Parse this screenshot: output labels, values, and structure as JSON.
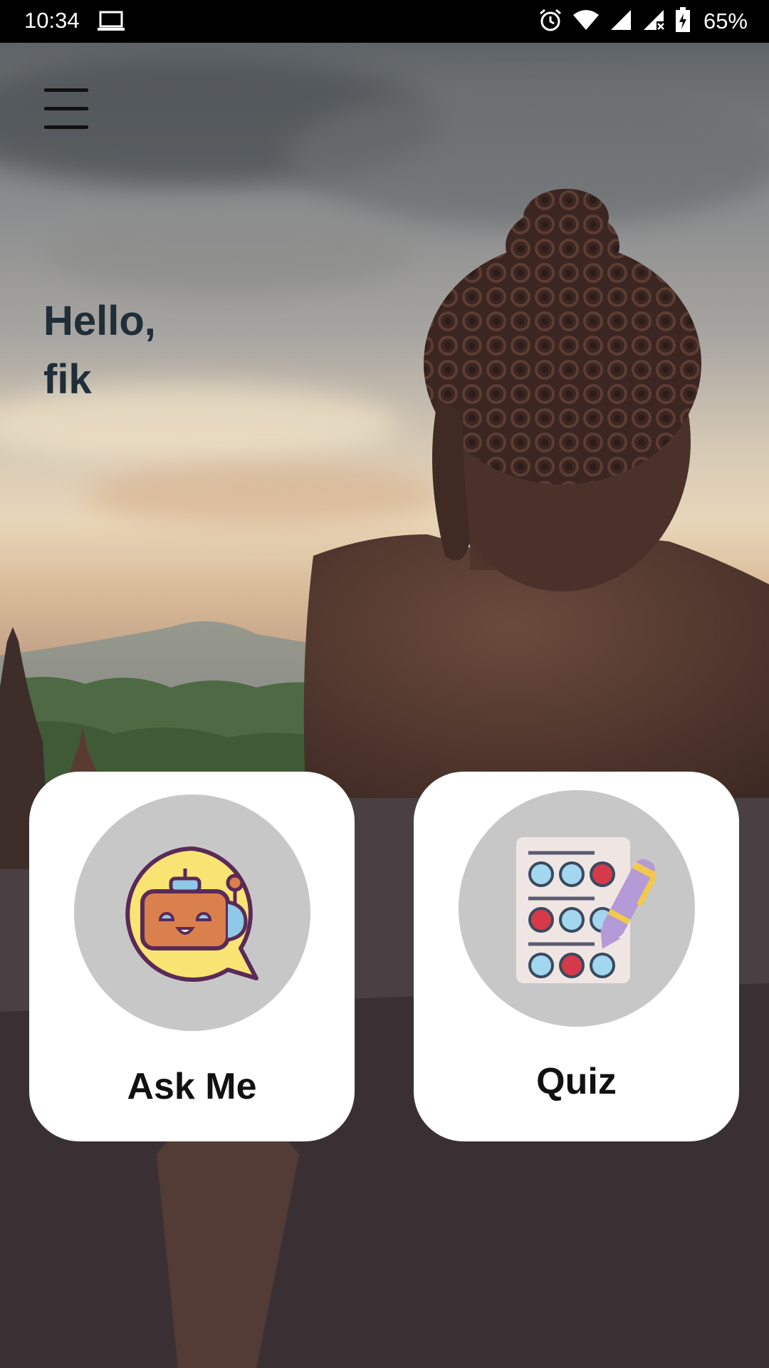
{
  "status_bar": {
    "time": "10:34",
    "battery": "65%",
    "icons": [
      "laptop-icon",
      "alarm-icon",
      "wifi-icon",
      "signal-icon",
      "signal-x-icon",
      "battery-charging-icon"
    ]
  },
  "menu": {
    "icon": "hamburger-menu-icon"
  },
  "greeting": {
    "line1": "Hello,",
    "line2": "fik"
  },
  "cards": [
    {
      "label": "Ask Me",
      "icon": "chatbot-icon"
    },
    {
      "label": "Quiz",
      "icon": "quiz-sheet-icon"
    }
  ],
  "colors": {
    "card_background": "#ffffff",
    "icon_circle": "#c8c7c8",
    "greeting_text": "#1f2e38"
  }
}
